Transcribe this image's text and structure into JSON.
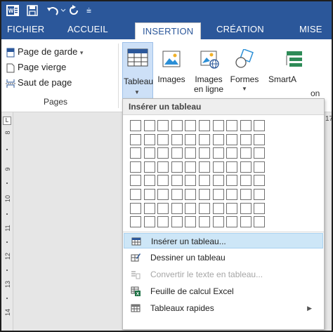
{
  "ribbon_tabs": {
    "file": "FICHIER",
    "home": "ACCUEIL",
    "insert": "INSERTION",
    "design": "CRÉATION",
    "layout": "MISE"
  },
  "pages_group": {
    "cover_page": "Page de garde",
    "cover_arrow": "▾",
    "blank_page": "Page vierge",
    "page_break": "Saut de page",
    "label": "Pages"
  },
  "tables_group": {
    "table_label": "Tableau"
  },
  "illustrations": {
    "images": "Images",
    "online_images_line1": "Images",
    "online_images_line2": "en ligne",
    "shapes": "Formes",
    "smartart": "SmartA"
  },
  "ribbon_cut_text": "on",
  "doc_number": "17",
  "ruler": {
    "corner": "L",
    "marks": [
      "8",
      "9",
      "10",
      "11",
      "12",
      "13",
      "14"
    ]
  },
  "dropdown": {
    "header": "Insérer un tableau",
    "grid_cols": 10,
    "grid_rows": 8,
    "items": [
      {
        "label": "Insérer un tableau...",
        "icon": "table-icon",
        "highlighted": true,
        "disabled": false
      },
      {
        "label": "Dessiner un tableau",
        "icon": "draw-table-icon",
        "highlighted": false,
        "disabled": false
      },
      {
        "label": "Convertir le texte en tableau...",
        "icon": "convert-text-icon",
        "highlighted": false,
        "disabled": true
      },
      {
        "label": "Feuille de calcul Excel",
        "icon": "excel-icon",
        "highlighted": false,
        "disabled": false
      },
      {
        "label": "Tableaux rapides",
        "icon": "quick-tables-icon",
        "highlighted": false,
        "disabled": false,
        "submenu": true
      }
    ]
  },
  "colors": {
    "word_blue": "#2b579a",
    "highlight": "#cde6f7"
  }
}
